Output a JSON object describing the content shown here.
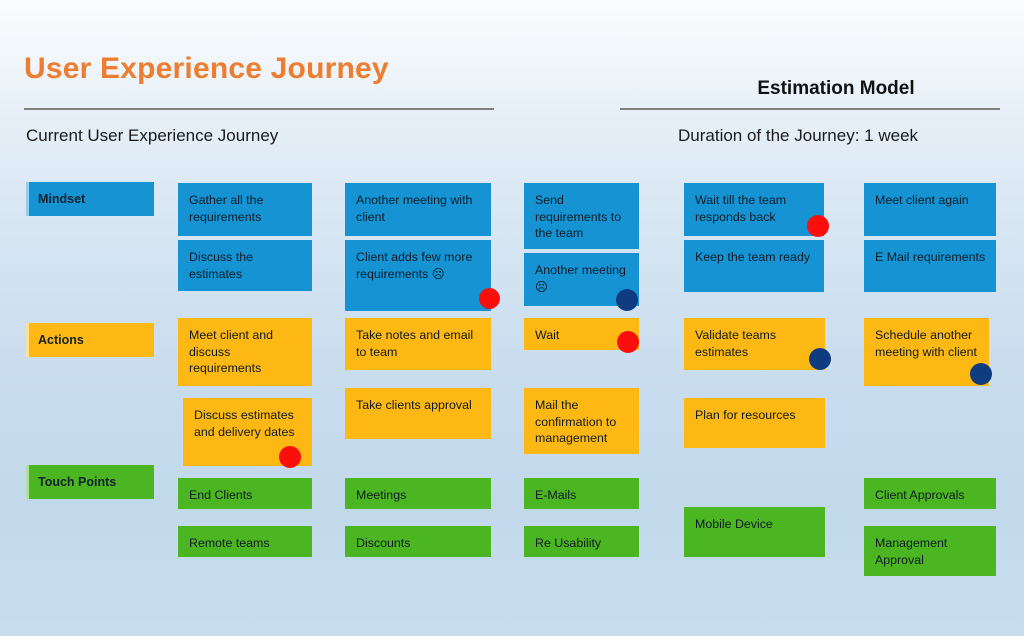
{
  "header": {
    "title": "User Experience Journey",
    "right_title": "Estimation Model",
    "left_caption": "Current User Experience Journey",
    "right_caption": "Duration of the Journey: 1 week"
  },
  "row_labels": [
    {
      "label": "Mindset",
      "color": "#1593D3"
    },
    {
      "label": "Actions",
      "color": "#FDB813"
    },
    {
      "label": "Touch Points",
      "color": "#4CB522"
    }
  ],
  "colors": {
    "accent_title": "#ED7D31",
    "mindset_blue": "#1593D3",
    "actions_orange": "#FDB813",
    "touch_green": "#4CB522",
    "dot_red": "#FA0F0C",
    "dot_navy": "#0F3C80",
    "rule": "#7F7F7F"
  },
  "cards": {
    "mindset": [
      "Gather all the requirements",
      "Discuss the estimates",
      "Another meeting with client",
      "Client adds few more requirements ☹",
      "Send requirements to the team",
      "Another meeting ☹",
      "Wait till the team responds back",
      "Keep the team ready",
      "Meet client again",
      "E Mail requirements"
    ],
    "actions": [
      "Meet client and discuss requirements",
      "Discuss estimates and delivery dates",
      "Take notes and email to team",
      "Take clients approval",
      "Wait",
      "Mail the confirmation to management",
      "Validate teams estimates",
      "Plan for resources",
      "Schedule another meeting with client"
    ],
    "touch_points": [
      "End Clients",
      "Remote teams",
      "Meetings",
      "Discounts",
      "E-Mails",
      "Re Usability",
      "Mobile Device",
      "Client Approvals",
      "Management Approval"
    ]
  }
}
